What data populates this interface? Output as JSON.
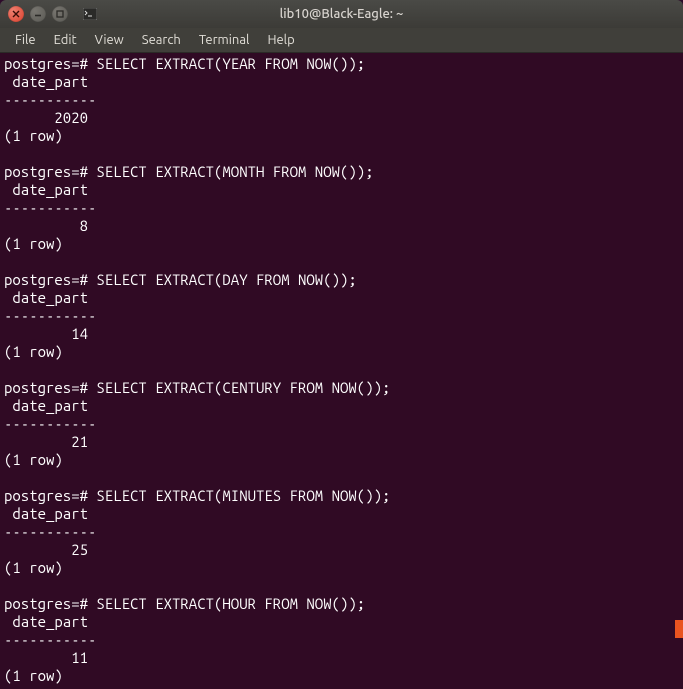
{
  "window": {
    "title": "lib10@Black-Eagle: ~"
  },
  "menubar": {
    "items": [
      "File",
      "Edit",
      "View",
      "Search",
      "Terminal",
      "Help"
    ]
  },
  "terminal": {
    "prompt": "postgres=#",
    "queries": [
      {
        "sql": "SELECT EXTRACT(YEAR FROM NOW());",
        "column": "date_part",
        "value": "2020",
        "rows_text": "(1 row)"
      },
      {
        "sql": "SELECT EXTRACT(MONTH FROM NOW());",
        "column": "date_part",
        "value": "8",
        "rows_text": "(1 row)"
      },
      {
        "sql": "SELECT EXTRACT(DAY FROM NOW());",
        "column": "date_part",
        "value": "14",
        "rows_text": "(1 row)"
      },
      {
        "sql": "SELECT EXTRACT(CENTURY FROM NOW());",
        "column": "date_part",
        "value": "21",
        "rows_text": "(1 row)"
      },
      {
        "sql": "SELECT EXTRACT(MINUTES FROM NOW());",
        "column": "date_part",
        "value": "25",
        "rows_text": "(1 row)"
      },
      {
        "sql": "SELECT EXTRACT(HOUR FROM NOW());",
        "column": "date_part",
        "value": "11",
        "rows_text": "(1 row)"
      }
    ],
    "separator": "-----------",
    "value_width": 10
  },
  "colors": {
    "terminal_bg": "#300a24",
    "terminal_fg": "#ffffff",
    "accent": "#e95420"
  }
}
